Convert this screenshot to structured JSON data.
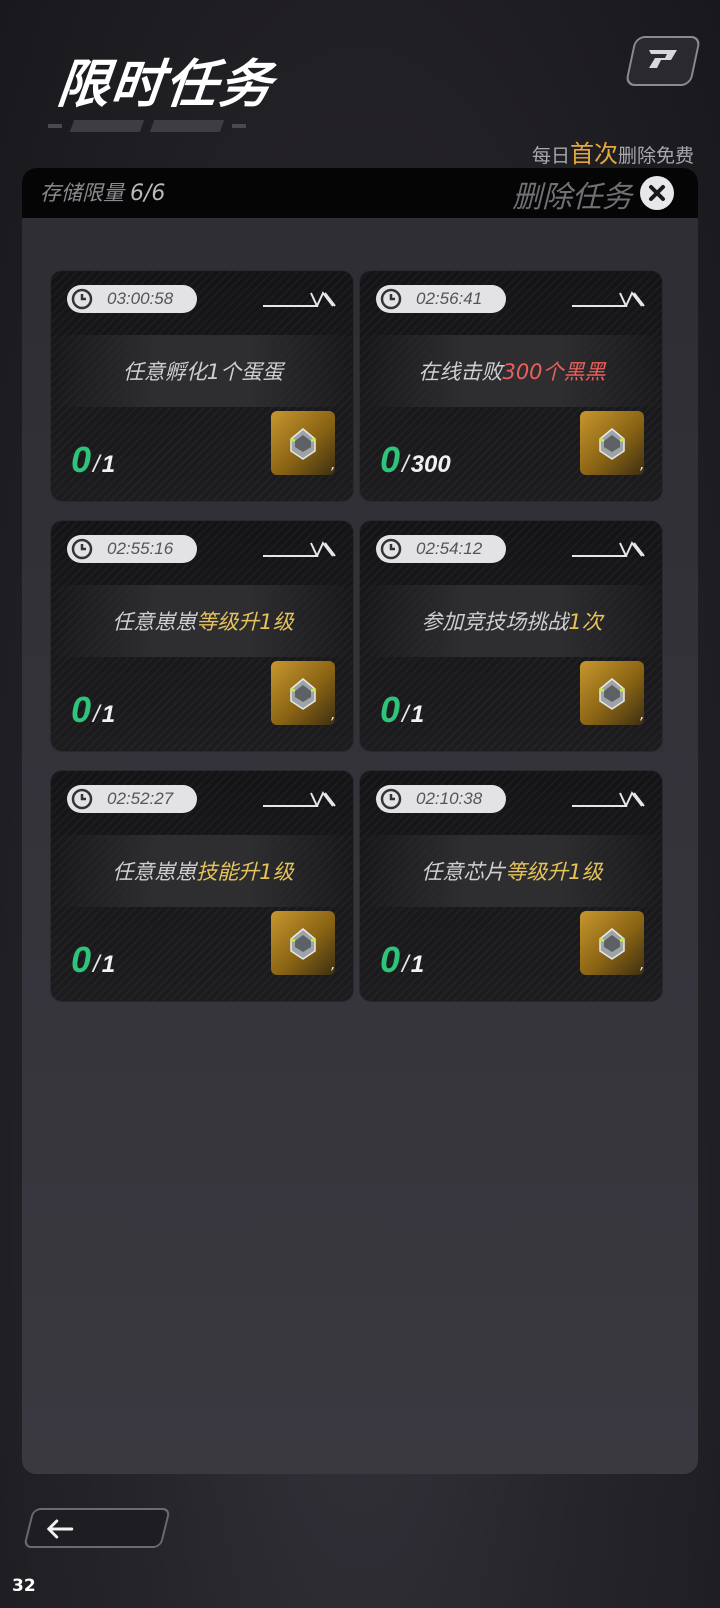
{
  "header": {
    "title": "限时任务",
    "free_note": {
      "prefix": "每日",
      "highlight": "首次",
      "suffix": "删除免费"
    }
  },
  "panel": {
    "storage_label": "存储限量",
    "storage_value": "6/6",
    "delete_label": "删除任务"
  },
  "tasks": [
    {
      "timer": "03:00:58",
      "text_plain": "任意孵化1个蛋蛋",
      "text_hl": "",
      "hl_color": "",
      "current": "0",
      "sep": "/",
      "total": "1",
      "reward_count": ","
    },
    {
      "timer": "02:56:41",
      "text_plain": "在线击败",
      "text_hl": "300个黑黑",
      "hl_color": "red",
      "current": "0",
      "sep": "/",
      "total": "300",
      "reward_count": ","
    },
    {
      "timer": "02:55:16",
      "text_plain": "任意崽崽",
      "text_hl": "等级升1级",
      "hl_color": "yellow",
      "current": "0",
      "sep": "/",
      "total": "1",
      "reward_count": ","
    },
    {
      "timer": "02:54:12",
      "text_plain": "参加竞技场挑战",
      "text_hl": "1次",
      "hl_color": "yellow",
      "current": "0",
      "sep": "/",
      "total": "1",
      "reward_count": ","
    },
    {
      "timer": "02:52:27",
      "text_plain": "任意崽崽",
      "text_hl": "技能升1级",
      "hl_color": "yellow",
      "current": "0",
      "sep": "/",
      "total": "1",
      "reward_count": ","
    },
    {
      "timer": "02:10:38",
      "text_plain": "任意芯片",
      "text_hl": "等级升1级",
      "hl_color": "yellow",
      "current": "0",
      "sep": "/",
      "total": "1",
      "reward_count": ","
    }
  ],
  "footer": {
    "page_number": "32"
  },
  "colors": {
    "progress_green": "#2ec47a",
    "highlight_yellow": "#e6c35a",
    "highlight_red": "#e8605c",
    "accent_orange": "#e5a83a"
  }
}
